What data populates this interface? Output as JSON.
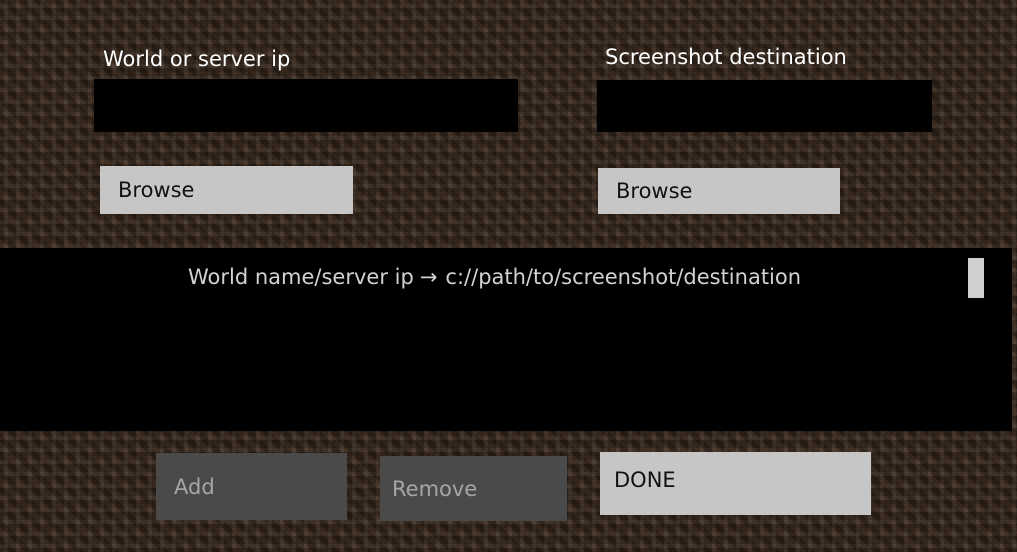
{
  "world_input": {
    "label": "World or server ip",
    "value": "",
    "placeholder": ""
  },
  "destination_input": {
    "label": "Screenshot destination",
    "value": "",
    "placeholder": ""
  },
  "browse_left": {
    "label": "Browse"
  },
  "browse_right": {
    "label": "Browse"
  },
  "list": {
    "rows": [
      {
        "source": "World name/server ip",
        "destination": "c://path/to/screenshot/destination"
      }
    ]
  },
  "actions": {
    "add_label": "Add",
    "remove_label": "Remove",
    "done_label": "DONE"
  }
}
